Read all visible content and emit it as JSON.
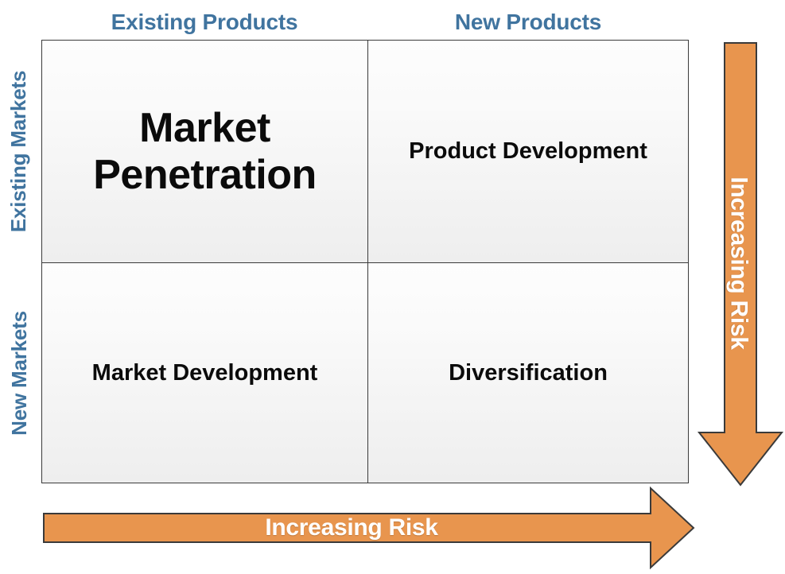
{
  "diagram": {
    "type": "ansoff-matrix",
    "columns": [
      {
        "key": "existing_products",
        "label": "Existing Products"
      },
      {
        "key": "new_products",
        "label": "New Products"
      }
    ],
    "rows": [
      {
        "key": "existing_markets",
        "label": "Existing Markets"
      },
      {
        "key": "new_markets",
        "label": "New Markets"
      }
    ],
    "quadrants": [
      {
        "key": "market_penetration",
        "label": "Market Penetration",
        "row": "existing_markets",
        "column": "existing_products",
        "emphasis": "large"
      },
      {
        "key": "product_development",
        "label": "Product Development",
        "row": "existing_markets",
        "column": "new_products",
        "emphasis": "normal"
      },
      {
        "key": "market_development",
        "label": "Market Development",
        "row": "new_markets",
        "column": "existing_products",
        "emphasis": "normal"
      },
      {
        "key": "diversification",
        "label": "Diversification",
        "row": "new_markets",
        "column": "new_products",
        "emphasis": "normal"
      }
    ],
    "arrows": [
      {
        "key": "vertical_risk",
        "label": "Increasing Risk",
        "direction": "down",
        "orientation": "vertical"
      },
      {
        "key": "horizontal_risk",
        "label": "Increasing Risk",
        "direction": "right",
        "orientation": "horizontal"
      }
    ],
    "colors": {
      "header_blue": "#40749f",
      "arrow_orange": "#e8954e",
      "arrow_outline": "#3a3a3a",
      "arrow_text": "#ffffff",
      "grid_border": "#3a3a3a",
      "cell_top": "#fdfdfd",
      "cell_bottom": "#eeeeee",
      "quadrant_text": "#0b0b0b",
      "background": "#ffffff"
    }
  }
}
